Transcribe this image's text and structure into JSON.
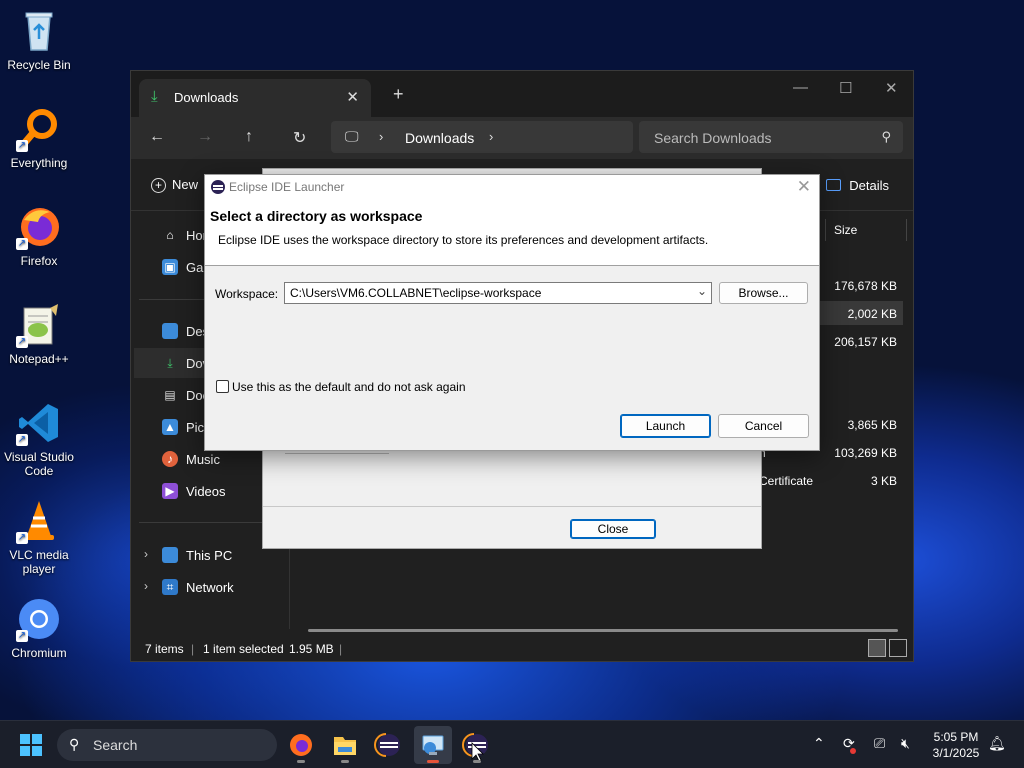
{
  "desktop": {
    "icons": [
      {
        "label": "Recycle Bin",
        "icon": "recycle-bin-icon"
      },
      {
        "label": "Everything",
        "icon": "magnifier-icon"
      },
      {
        "label": "Firefox",
        "icon": "firefox-icon"
      },
      {
        "label": "Notepad++",
        "icon": "notepad-plus-plus-icon"
      },
      {
        "label": "Visual Studio Code",
        "icon": "vscode-icon"
      },
      {
        "label": "VLC media player",
        "icon": "vlc-cone-icon"
      },
      {
        "label": "Chromium",
        "icon": "chromium-icon"
      }
    ]
  },
  "explorer": {
    "tab_label": "Downloads",
    "breadcrumb": "Downloads",
    "search_placeholder": "Search Downloads",
    "new_label": "New",
    "details_label": "Details",
    "size_header": "Size",
    "sidebar": [
      {
        "label": "Home"
      },
      {
        "label": "Gallery"
      },
      {
        "label": "Desktop"
      },
      {
        "label": "Downloads"
      },
      {
        "label": "Documents"
      },
      {
        "label": "Pictures"
      },
      {
        "label": "Music"
      },
      {
        "label": "Videos"
      },
      {
        "label": "This PC"
      },
      {
        "label": "Network"
      }
    ],
    "sidebar_visible": [
      "Hor",
      "Gal",
      "Des",
      "Dov",
      "Doc",
      "Pict",
      "Music",
      "Videos",
      "This PC",
      "Network"
    ],
    "rows": [
      {
        "type": "",
        "size": "176,678 KB"
      },
      {
        "type": "",
        "size": "2,002 KB"
      },
      {
        "type": "",
        "size": "206,157 KB"
      },
      {
        "type": "",
        "size": "3,865 KB"
      },
      {
        "type": "n",
        "size": "103,269 KB"
      },
      {
        "type": "Certificate",
        "size": "3 KB"
      }
    ],
    "status": {
      "items": "7 items",
      "selected": "1 item selected",
      "selected_size": "1.95 MB"
    }
  },
  "background_dialog": {
    "close_label": "Close"
  },
  "eclipse": {
    "title": "Eclipse IDE Launcher",
    "heading": "Select a directory as workspace",
    "description": "Eclipse IDE uses the workspace directory to store its preferences and development artifacts.",
    "workspace_label": "Workspace:",
    "workspace_value": "C:\\Users\\VM6.COLLABNET\\eclipse-workspace",
    "browse_label": "Browse...",
    "default_checkbox_label": "Use this as the default and do not ask again",
    "default_checked": false,
    "launch_label": "Launch",
    "cancel_label": "Cancel"
  },
  "taskbar": {
    "search_label": "Search",
    "time": "5:05 PM",
    "date": "3/1/2025"
  },
  "colors": {
    "accent": "#0067c0",
    "explorer_bg": "#202020",
    "taskbar_bg": "#1b1f2a"
  }
}
